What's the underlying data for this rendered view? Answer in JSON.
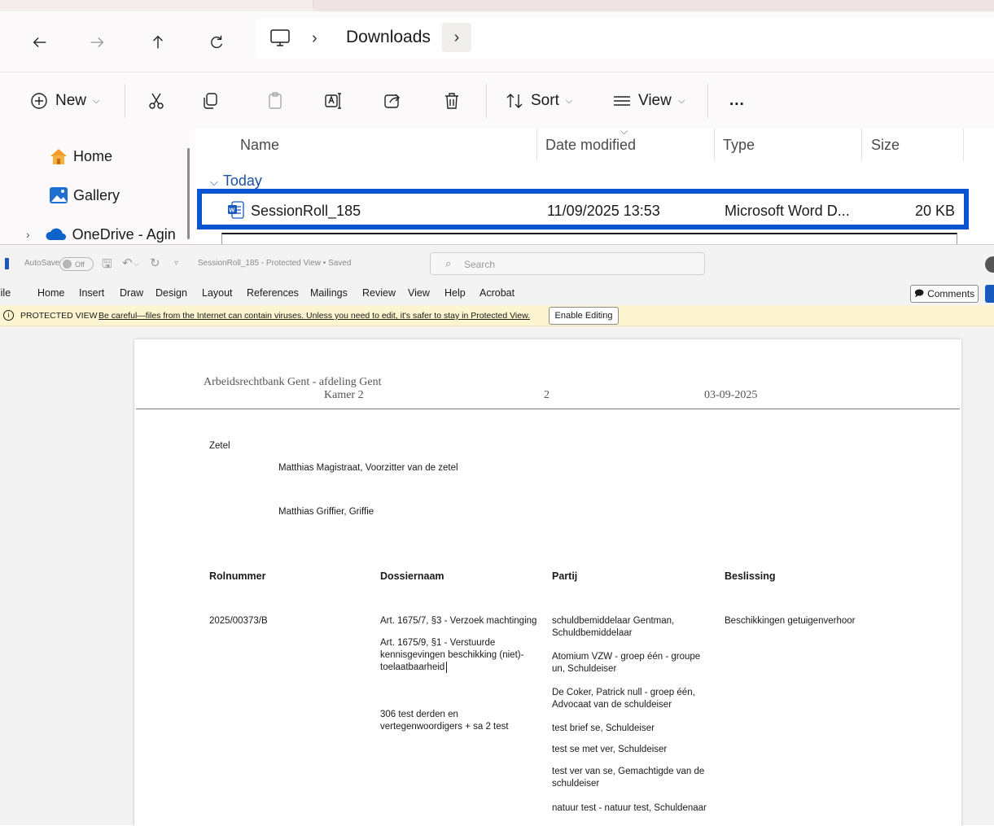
{
  "explorer": {
    "address": {
      "crumb": "Downloads"
    },
    "toolbar": {
      "new": "New",
      "sort": "Sort",
      "view": "View",
      "more": "..."
    },
    "sidebar": [
      {
        "label": "Home",
        "icon": "home-icon"
      },
      {
        "label": "Gallery",
        "icon": "gallery-icon"
      },
      {
        "label": "OneDrive - Agin",
        "icon": "onedrive-icon"
      }
    ],
    "columns": {
      "name": "Name",
      "date": "Date modified",
      "type": "Type",
      "size": "Size"
    },
    "group": "Today",
    "file": {
      "name": "SessionRoll_185",
      "date": "11/09/2025 13:53",
      "type": "Microsoft Word D...",
      "size": "20 KB"
    },
    "accent": "#0a54d4"
  },
  "word": {
    "autosave": "AutoSave",
    "toggle": "Off",
    "title": "SessionRoll_185  -  Protected View • Saved",
    "search": "Search",
    "menu": [
      "File",
      "Home",
      "Insert",
      "Draw",
      "Design",
      "Layout",
      "References",
      "Mailings",
      "Review",
      "View",
      "Help",
      "Acrobat"
    ],
    "comments": "Comments",
    "protected": {
      "title": "PROTECTED VIEW",
      "message": "Be careful—files from the Internet can contain viruses. Unless you need to edit, it's safer to stay in Protected View.",
      "button": "Enable Editing"
    },
    "doc": {
      "court": "Arbeidsrechtbank Gent - afdeling Gent",
      "chamber": "Kamer 2",
      "page": "2",
      "date": "03-09-2025",
      "zetel_label": "Zetel",
      "zetel": [
        "Matthias Magistraat, Voorzitter van de zetel",
        "Matthias Griffier, Griffie"
      ],
      "headers": {
        "rol": "Rolnummer",
        "dossier": "Dossiernaam",
        "partij": "Partij",
        "beslissing": "Beslissing"
      },
      "rolnummer": "2025/00373/B",
      "dossiers": [
        "Art. 1675/7, §3 - Verzoek machtinging",
        "Art. 1675/9, §1 - Verstuurde kennisgevingen beschikking (niet)-toelaatbaarheid",
        "306 test derden en vertegenwoordigers + sa 2 test"
      ],
      "partijen": [
        "schuldbemiddelaar Gentman, Schuldbemiddelaar",
        "Atomium VZW - groep één - groupe un, Schuldeiser",
        "De Coker, Patrick null - groep één, Advocaat van de schuldeiser",
        "test brief se, Schuldeiser",
        "test se met ver, Schuldeiser",
        "test ver van se, Gemachtigde van de schuldeiser",
        "natuur test - natuur test, Schuldenaar"
      ],
      "beslissing": "Beschikkingen getuigenverhoor"
    }
  }
}
